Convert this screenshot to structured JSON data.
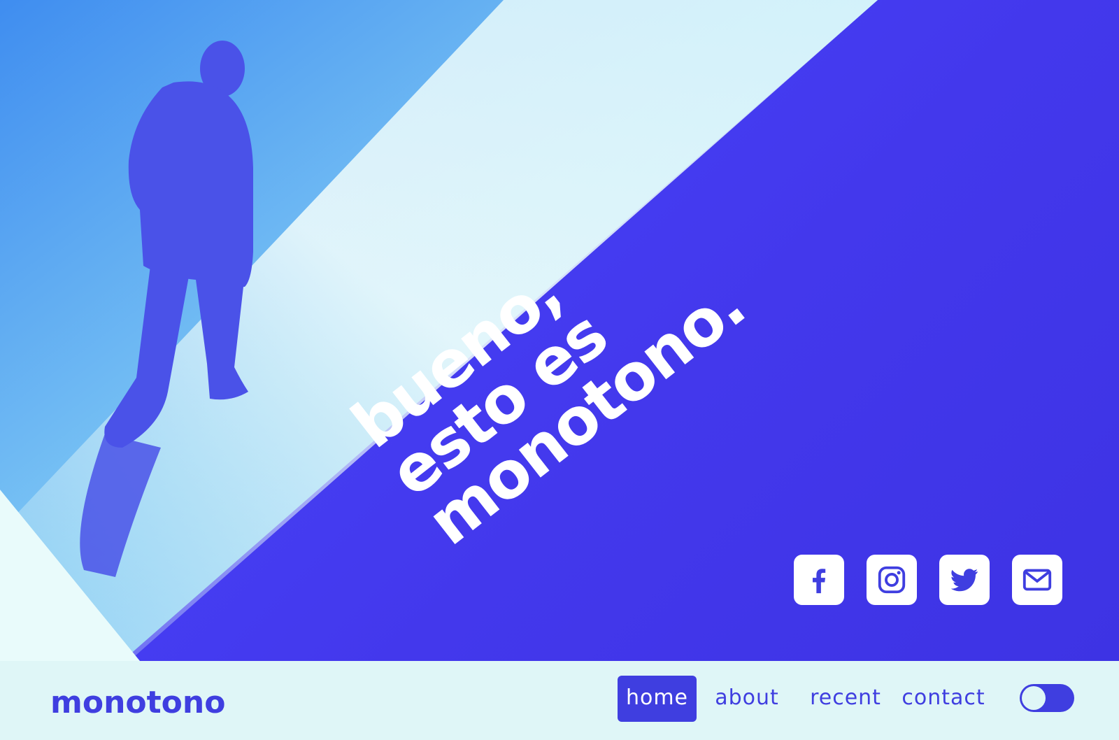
{
  "colors": {
    "accent": "#3f3ee0",
    "hero_blue": "#4542ee",
    "light_background": "#dff6f7",
    "white": "#ffffff"
  },
  "hero": {
    "headline": [
      "bueno,",
      "esto es",
      "monotono."
    ],
    "image": "silhouette-person-walking-photo",
    "social": [
      {
        "icon": "facebook-icon"
      },
      {
        "icon": "instagram-icon"
      },
      {
        "icon": "twitter-icon"
      },
      {
        "icon": "mail-icon"
      }
    ]
  },
  "navbar": {
    "logo": "monotono",
    "items": [
      {
        "label": "home",
        "active": true
      },
      {
        "label": "about",
        "active": false
      },
      {
        "label": "recent",
        "active": false
      },
      {
        "label": "contact",
        "active": false
      }
    ],
    "theme_toggle": {
      "icon": "theme-toggle-icon"
    }
  }
}
